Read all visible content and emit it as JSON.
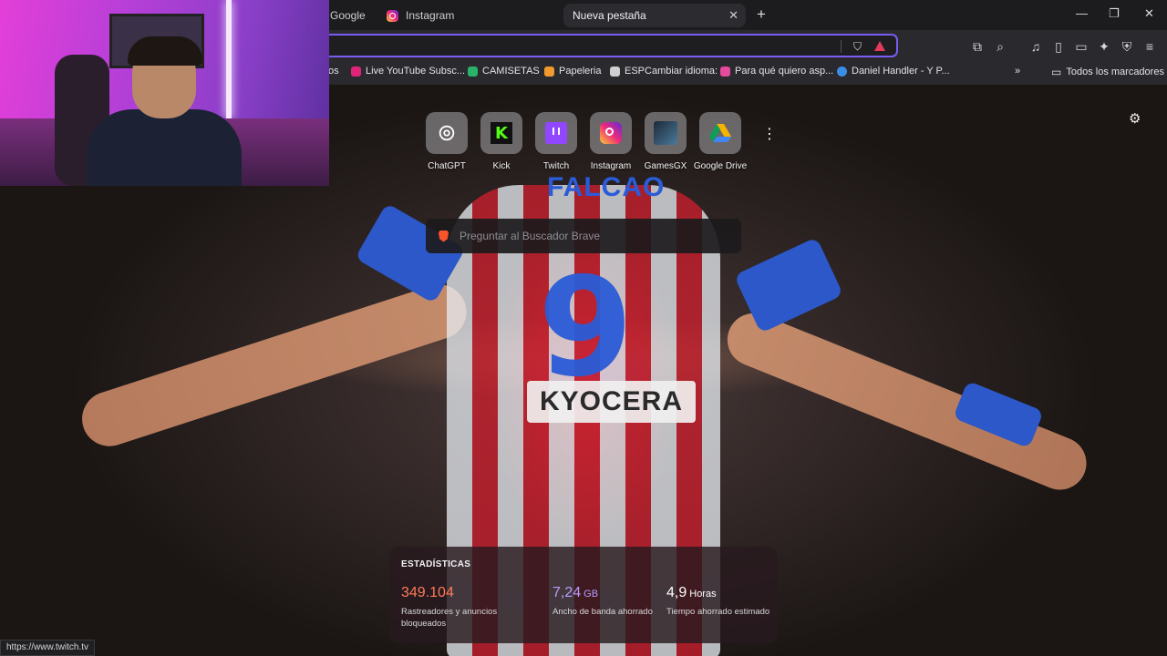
{
  "tabs": [
    {
      "label": "Google"
    },
    {
      "label": "Instagram"
    },
    {
      "label": "Nueva pestaña"
    }
  ],
  "bookmarks": [
    {
      "label": "os"
    },
    {
      "label": "Live YouTube Subsc..."
    },
    {
      "label": "CAMISETAS"
    },
    {
      "label": "Papeleria"
    },
    {
      "label": "ESPCambiar idioma:"
    },
    {
      "label": "Para qué quiero asp..."
    },
    {
      "label": "Daniel Handler - Y P..."
    }
  ],
  "all_bookmarks_label": "Todos los marcadores",
  "top_sites": [
    {
      "label": "ChatGPT",
      "icon": "openai-icon"
    },
    {
      "label": "Kick",
      "icon": "kick-icon"
    },
    {
      "label": "Twitch",
      "icon": "twitch-icon"
    },
    {
      "label": "Instagram",
      "icon": "instagram-icon"
    },
    {
      "label": "GamesGX",
      "icon": "gamesgx-icon"
    },
    {
      "label": "Google Drive",
      "icon": "google-drive-icon"
    }
  ],
  "search": {
    "placeholder": "Preguntar al Buscador Brave"
  },
  "background_text": {
    "shirt_name": "FALCAO",
    "shirt_number": "9",
    "sponsor": "KYOCERA"
  },
  "stats": {
    "title": "ESTADÍSTICAS",
    "items": [
      {
        "value": "349.104",
        "unit": "",
        "desc": "Rastreadores y anuncios bloqueados",
        "color": "#ff7a59"
      },
      {
        "value": "7,24",
        "unit": "GB",
        "desc": "Ancho de banda ahorrado",
        "color": "#b99cff"
      },
      {
        "value": "4,9",
        "unit": "Horas",
        "desc": "Tiempo ahorrado estimado",
        "color": "#ffffff"
      }
    ]
  },
  "status_url": "https://www.twitch.tv",
  "colors": {
    "accent": "#7b5cf3",
    "brave": "#fb542b",
    "twitch": "#9146ff",
    "kick": "#53fc18"
  }
}
